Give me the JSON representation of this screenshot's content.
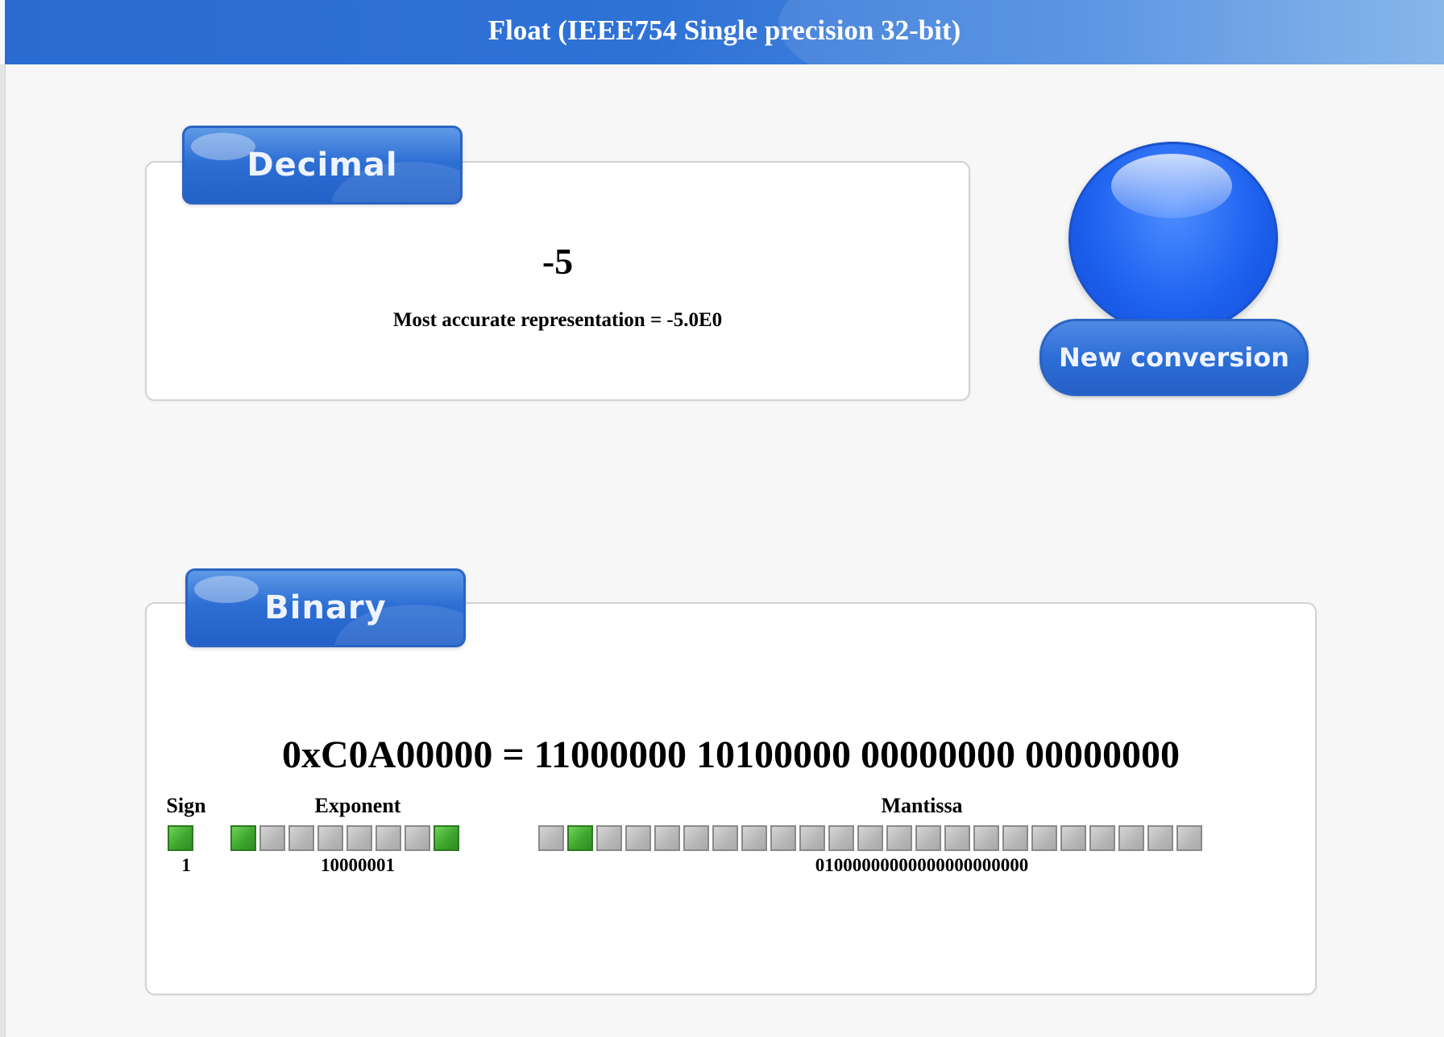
{
  "header": {
    "title": "Float (IEEE754 Single precision 32-bit)"
  },
  "decimal": {
    "tab_label": "Decimal",
    "value": "-5",
    "accurate": "Most accurate representation = -5.0E0"
  },
  "actions": {
    "new_conversion_label": "New conversion"
  },
  "binary": {
    "tab_label": "Binary",
    "hex_line": "0xC0A00000 = 11000000 10100000 00000000 00000000",
    "sign": {
      "label": "Sign",
      "value": "1"
    },
    "exponent": {
      "label": "Exponent",
      "value": "10000001"
    },
    "mantissa": {
      "label": "Mantissa",
      "value": "01000000000000000000000"
    }
  },
  "colors": {
    "bit_on": "#3ea62e",
    "bit_off": "#b8b8b8",
    "accent": "#2e6fd4"
  }
}
